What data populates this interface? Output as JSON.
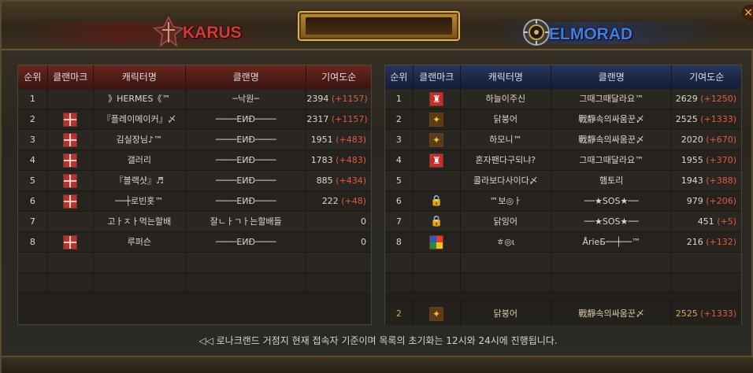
{
  "header": {
    "left_faction": "KARUS",
    "right_faction": "ELMORAD",
    "close_glyph": "×",
    "accent_left": "#d23a36",
    "accent_right": "#3f7ee0"
  },
  "columns": {
    "rank": "순위",
    "clan_mark": "클랜마크",
    "character": "캐릭터명",
    "clan_name": "클랜명",
    "contribution": "기여도순"
  },
  "karus": {
    "rows": [
      {
        "rank": "1",
        "mark": "none",
        "name": "》HERMES《™",
        "clan": "─낙원─",
        "score": "2394",
        "plus": "(+1157)"
      },
      {
        "rank": "2",
        "mark": "red-grid",
        "name": "『플레이메이커』〆",
        "clan": "────EИĐ────",
        "score": "2317",
        "plus": "(+1157)"
      },
      {
        "rank": "3",
        "mark": "red-grid",
        "name": "김실장님♪™",
        "clan": "────EИĐ────",
        "score": "1951",
        "plus": "(+483)"
      },
      {
        "rank": "4",
        "mark": "red-grid",
        "name": "갤러리",
        "clan": "────EИĐ────",
        "score": "1783",
        "plus": "(+483)"
      },
      {
        "rank": "5",
        "mark": "red-grid",
        "name": "『블랙샷』♬",
        "clan": "────EИĐ────",
        "score": "885",
        "plus": "(+434)"
      },
      {
        "rank": "6",
        "mark": "red-grid",
        "name": "──┼로빈홋™",
        "clan": "────EИĐ────",
        "score": "222",
        "plus": "(+48)"
      },
      {
        "rank": "7",
        "mark": "none",
        "name": "고ㅏㅈㅏ먹는할배",
        "clan": "잘ㄴㅏㄱㅏ는할배들",
        "score": "0",
        "plus": ""
      },
      {
        "rank": "8",
        "mark": "red-grid",
        "name": "루퍼슨",
        "clan": "────EИĐ────",
        "score": "0",
        "plus": ""
      }
    ]
  },
  "elmorad": {
    "rows": [
      {
        "rank": "1",
        "mark": "red-flag",
        "name": "하늘이주신",
        "clan": "그때그때달라요™",
        "score": "2629",
        "plus": "(+1250)"
      },
      {
        "rank": "2",
        "mark": "gold",
        "name": "닭붕어",
        "clan": "戰靜속의싸움꾼〆",
        "score": "2525",
        "plus": "(+1333)"
      },
      {
        "rank": "3",
        "mark": "gold",
        "name": "하모니™",
        "clan": "戰靜속의싸움꾼〆",
        "score": "2020",
        "plus": "(+670)"
      },
      {
        "rank": "4",
        "mark": "red-flag",
        "name": "혼자팬다구되냐?",
        "clan": "그때그때달라요™",
        "score": "1955",
        "plus": "(+370)"
      },
      {
        "rank": "5",
        "mark": "none",
        "name": "콜라보다사이다〆",
        "clan": "햄토리",
        "score": "1943",
        "plus": "(+388)"
      },
      {
        "rank": "6",
        "mark": "lock",
        "name": "™보◎ㅏ",
        "clan": "──★SOS★──",
        "score": "979",
        "plus": "(+206)"
      },
      {
        "rank": "7",
        "mark": "lock",
        "name": "닭잉어",
        "clan": "──★SOS★──",
        "score": "451",
        "plus": "(+5)"
      },
      {
        "rank": "8",
        "mark": "color",
        "name": "ㅎ◎ι",
        "clan": "ÅrieБ──┼──™",
        "score": "216",
        "plus": "(+132)"
      }
    ],
    "pinned": {
      "rank": "2",
      "mark": "gold",
      "name": "닭붕어",
      "clan": "戰靜속의싸움꾼〆",
      "score": "2525",
      "plus": "(+1333)"
    }
  },
  "footer": {
    "text": "◁◁ 로나크랜드 거점지 현재 접속자 기준이며 목록의 초기화는 12시와 24시에 진행됩니다."
  }
}
